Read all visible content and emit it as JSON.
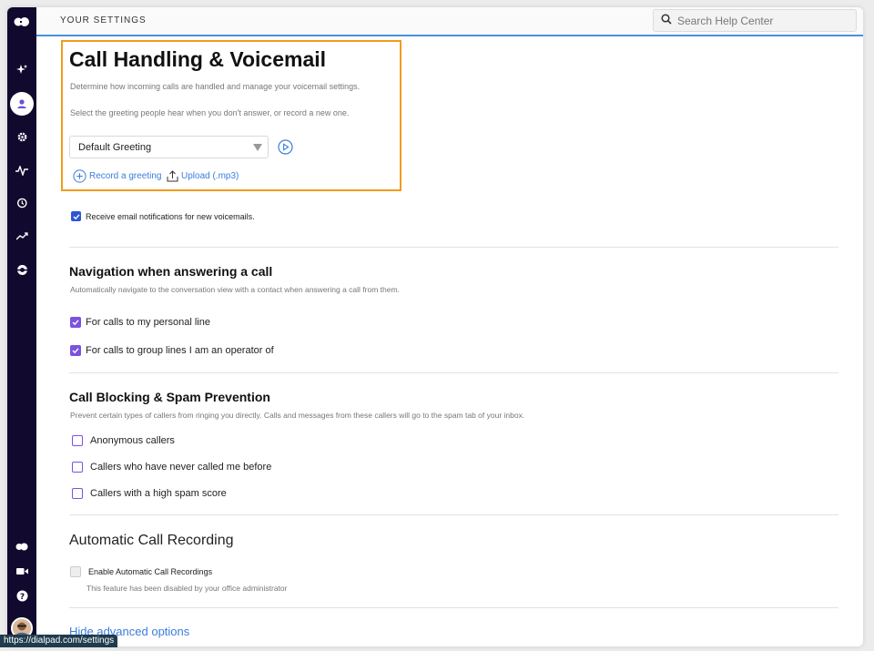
{
  "header": {
    "title": "YOUR SETTINGS",
    "search_placeholder": "Search Help Center"
  },
  "rail": {
    "icons": [
      "dialpad-logo-icon",
      "ai-sparkle-icon",
      "user-icon",
      "gear-icon",
      "activity-icon",
      "history-icon",
      "trending-icon",
      "support-icon",
      "dialpad-small-icon",
      "video-icon",
      "help-icon",
      "avatar"
    ]
  },
  "voicemail": {
    "title": "Call Handling & Voicemail",
    "description": "Determine how incoming calls are handled and manage your voicemail settings.",
    "greeting_hint": "Select the greeting people hear when you don't answer, or record a new one.",
    "greeting_value": "Default Greeting",
    "record_label": "Record a greeting",
    "upload_label": "Upload (.mp3)",
    "email_notify_label": "Receive email notifications for new voicemails."
  },
  "navigation": {
    "title": "Navigation when answering a call",
    "description": "Automatically navigate to the conversation view with a contact when answering a call from them.",
    "options": [
      "For calls to my personal line",
      "For calls to group lines I am an operator of"
    ]
  },
  "blocking": {
    "title": "Call Blocking & Spam Prevention",
    "description": "Prevent certain types of callers from ringing you directly. Calls and messages from these callers will go to the spam tab of your inbox.",
    "options": [
      "Anonymous callers",
      "Callers who have never called me before",
      "Callers with a high spam score"
    ]
  },
  "recording": {
    "title": "Automatic Call Recording",
    "option_label": "Enable Automatic Call Recordings",
    "disabled_note": "This feature has been disabled by your office administrator"
  },
  "footer": {
    "hide_link": "Hide advanced options",
    "status_url": "https://dialpad.com/settings"
  },
  "colors": {
    "rail": "#110a2e",
    "accent_blue": "#3b7ddd",
    "accent_purple": "#7c52e0",
    "highlight_orange": "#f29b1d"
  }
}
